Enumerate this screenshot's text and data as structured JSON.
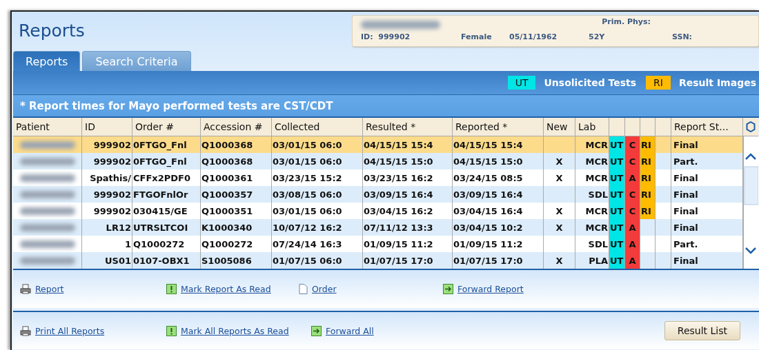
{
  "window": {
    "title": "Reports"
  },
  "patient": {
    "prim_phys_label": "Prim. Phys:",
    "id_label": "ID:",
    "id": "999902",
    "sex": "Female",
    "dob": "05/11/1962",
    "age": "52Y",
    "ssn_label": "SSN:"
  },
  "tabs": [
    {
      "label": "Reports",
      "selected": true
    },
    {
      "label": "Search Criteria",
      "selected": false
    }
  ],
  "legend": [
    {
      "code": "UT",
      "label": "Unsolicited Tests",
      "color": "#00e5e5"
    },
    {
      "code": "RI",
      "label": "Result Images",
      "color": "#ffbb00"
    }
  ],
  "notice": "* Report times for Mayo performed tests are CST/CDT",
  "table": {
    "columns": [
      "Patient",
      "ID",
      "Order #",
      "Accession #",
      "Collected",
      "Resulted *",
      "Reported *",
      "New",
      "Lab",
      "",
      "",
      "",
      "",
      "Report St..."
    ],
    "rows": [
      {
        "selected": true,
        "id": "999902",
        "order": "0FTGO_Fnl",
        "accession": "Q1000368",
        "collected": "03/01/15 06:0",
        "resulted": "04/15/15 15:4",
        "reported": "04/15/15 15:4",
        "lab": "MCR",
        "ut": "UT",
        "flag": "C",
        "ri": "RI",
        "status": "Final"
      },
      {
        "selected": false,
        "id": "999902",
        "order": "0FTGO_Fnl",
        "accession": "Q1000368",
        "collected": "03/01/15 06:0",
        "resulted": "04/15/15 15:0",
        "reported": "04/15/15 15:0",
        "new": "X",
        "lab": "MCR",
        "ut": "UT",
        "flag": "C",
        "ri": "RI",
        "status": "Part."
      },
      {
        "selected": false,
        "id": "Spathis/",
        "order": "CFFx2PDF0",
        "accession": "Q1000361",
        "collected": "03/23/15 15:2",
        "resulted": "03/23/15 16:2",
        "reported": "03/24/15 08:5",
        "new": "X",
        "lab": "MCR",
        "ut": "UT",
        "flag": "A",
        "ri": "RI",
        "status": "Final"
      },
      {
        "selected": false,
        "id": "999902",
        "order": "FTGOFnlOr",
        "accession": "Q1000357",
        "collected": "03/08/15 06:0",
        "resulted": "03/09/15 16:4",
        "reported": "03/09/15 16:4",
        "lab": "SDL",
        "ut": "UT",
        "flag": "C",
        "ri": "RI",
        "status": "Final"
      },
      {
        "selected": false,
        "id": "999902",
        "order": "030415/GE",
        "accession": "Q1000351",
        "collected": "03/01/15 06:0",
        "resulted": "03/04/15 16:2",
        "reported": "03/04/15 16:4",
        "new": "X",
        "lab": "MCR",
        "ut": "UT",
        "flag": "C",
        "ri": "RI",
        "status": "Final"
      },
      {
        "selected": false,
        "id": "LR12",
        "order": "UTRSLTCOI",
        "accession": "K1000340",
        "collected": "10/07/12 16:2",
        "resulted": "07/11/12 13:3",
        "reported": "03/04/15 10:2",
        "new": "X",
        "lab": "MCR",
        "ut": "UT",
        "flag": "A",
        "status": "Final"
      },
      {
        "selected": false,
        "id": "1",
        "order": "Q1000272",
        "accession": "Q1000272",
        "collected": "07/24/14 16:3",
        "resulted": "01/09/15 11:2",
        "reported": "01/09/15 11:2",
        "lab": "SDL",
        "ut": "UT",
        "flag": "A",
        "status": "Part."
      },
      {
        "selected": false,
        "id": "US01",
        "order": "0107-OBX1",
        "accession": "S1005086",
        "collected": "01/07/15 06:0",
        "resulted": "01/07/15 17:0",
        "reported": "01/07/15 17:0",
        "new": "X",
        "lab": "PLA",
        "ut": "UT",
        "flag": "A",
        "status": "Final"
      }
    ]
  },
  "actions": [
    {
      "kind": "print",
      "label": "Report"
    },
    {
      "kind": "mark",
      "label": "Mark Report As Read"
    },
    {
      "kind": "document",
      "label": "Order"
    },
    {
      "kind": "forward",
      "label": "Forward Report"
    }
  ],
  "bulk_actions": [
    {
      "kind": "print",
      "label": "Print All Reports"
    },
    {
      "kind": "mark",
      "label": "Mark All Reports As Read"
    },
    {
      "kind": "forward",
      "label": "Forward All"
    }
  ],
  "buttons": [
    "Result List"
  ]
}
